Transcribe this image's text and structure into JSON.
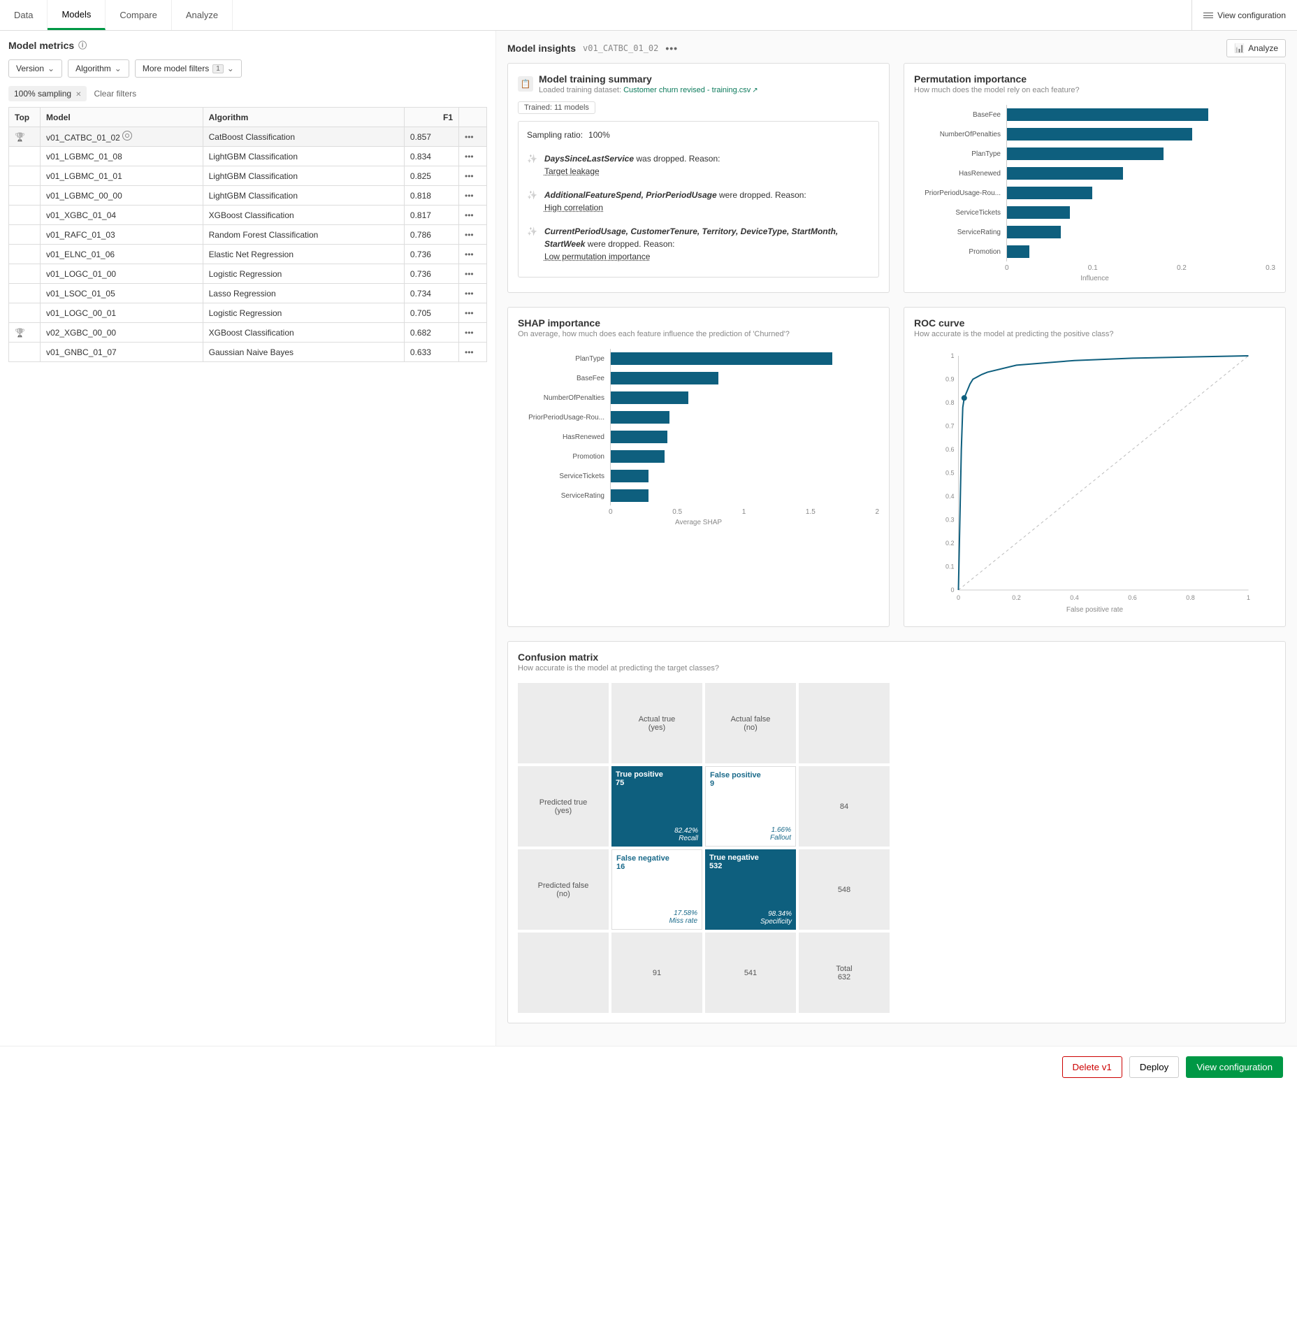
{
  "tabs": [
    "Data",
    "Models",
    "Compare",
    "Analyze"
  ],
  "active_tab": 1,
  "view_config": "View configuration",
  "left": {
    "title": "Model metrics",
    "filters": {
      "version": "Version",
      "algorithm": "Algorithm",
      "more": "More model filters",
      "more_count": "1"
    },
    "chip": "100% sampling",
    "clear": "Clear filters",
    "thead": {
      "top": "Top",
      "model": "Model",
      "algo": "Algorithm",
      "f1": "F1"
    },
    "rows": [
      {
        "top": true,
        "model": "v01_CATBC_01_02",
        "algo": "CatBoost Classification",
        "f1": "0.857",
        "sel": true
      },
      {
        "model": "v01_LGBMC_01_08",
        "algo": "LightGBM Classification",
        "f1": "0.834"
      },
      {
        "model": "v01_LGBMC_01_01",
        "algo": "LightGBM Classification",
        "f1": "0.825"
      },
      {
        "model": "v01_LGBMC_00_00",
        "algo": "LightGBM Classification",
        "f1": "0.818"
      },
      {
        "model": "v01_XGBC_01_04",
        "algo": "XGBoost Classification",
        "f1": "0.817"
      },
      {
        "model": "v01_RAFC_01_03",
        "algo": "Random Forest Classification",
        "f1": "0.786"
      },
      {
        "model": "v01_ELNC_01_06",
        "algo": "Elastic Net Regression",
        "f1": "0.736"
      },
      {
        "model": "v01_LOGC_01_00",
        "algo": "Logistic Regression",
        "f1": "0.736"
      },
      {
        "model": "v01_LSOC_01_05",
        "algo": "Lasso Regression",
        "f1": "0.734"
      },
      {
        "model": "v01_LOGC_00_01",
        "algo": "Logistic Regression",
        "f1": "0.705"
      },
      {
        "top": true,
        "model": "v02_XGBC_00_00",
        "algo": "XGBoost Classification",
        "f1": "0.682"
      },
      {
        "model": "v01_GNBC_01_07",
        "algo": "Gaussian Naive Bayes",
        "f1": "0.633"
      }
    ]
  },
  "right": {
    "title": "Model insights",
    "model_id": "v01_CATBC_01_02",
    "analyze": "Analyze",
    "train": {
      "title": "Model training summary",
      "sub_pref": "Loaded training dataset:",
      "dataset": "Customer churn revised - training.csv",
      "trained": "Trained: 11 models",
      "sampling_pref": "Sampling ratio:",
      "sampling_val": "100%",
      "insights": [
        {
          "bold": "DaysSinceLastService",
          "rest": " was dropped. Reason: ",
          "reason": "Target leakage"
        },
        {
          "bold": "AdditionalFeatureSpend, PriorPeriodUsage",
          "rest": " were dropped. Reason:",
          "reason": "High correlation"
        },
        {
          "bold": "CurrentPeriodUsage, CustomerTenure, Territory, DeviceType, StartMonth, StartWeek",
          "rest": " were dropped. Reason:",
          "reason": "Low permutation importance"
        }
      ]
    },
    "perm": {
      "title": "Permutation importance",
      "sub": "How much does the model rely on each feature?",
      "xlabel": "Influence"
    },
    "shap": {
      "title": "SHAP importance",
      "sub": "On average, how much does each feature influence the prediction of 'Churned'?",
      "xlabel": "Average SHAP"
    },
    "roc": {
      "title": "ROC curve",
      "sub": "How accurate is the model at predicting the positive class?",
      "xlabel": "False positive rate"
    },
    "conf": {
      "title": "Confusion matrix",
      "sub": "How accurate is the model at predicting the target classes?",
      "actual_true": "Actual true\n(yes)",
      "actual_false": "Actual false\n(no)",
      "pred_true": "Predicted true\n(yes)",
      "pred_false": "Predicted false\n(no)",
      "tp": {
        "t": "True positive",
        "n": "75",
        "p": "82.42%",
        "m": "Recall"
      },
      "fp": {
        "t": "False positive",
        "n": "9",
        "p": "1.66%",
        "m": "Fallout"
      },
      "fn": {
        "t": "False negative",
        "n": "16",
        "p": "17.58%",
        "m": "Miss rate"
      },
      "tn": {
        "t": "True negative",
        "n": "532",
        "p": "98.34%",
        "m": "Specificity"
      },
      "row_tot_1": "84",
      "row_tot_2": "548",
      "col_tot_1": "91",
      "col_tot_2": "541",
      "total_label": "Total",
      "total": "632"
    }
  },
  "footer": {
    "delete": "Delete v1",
    "deploy": "Deploy",
    "view": "View configuration"
  },
  "chart_data": [
    {
      "type": "bar",
      "orientation": "h",
      "title": "Permutation importance",
      "xlabel": "Influence",
      "xlim": [
        0,
        0.3
      ],
      "categories": [
        "BaseFee",
        "NumberOfPenalties",
        "PlanType",
        "HasRenewed",
        "PriorPeriodUsage-Rou...",
        "ServiceTickets",
        "ServiceRating",
        "Promotion"
      ],
      "values": [
        0.225,
        0.207,
        0.175,
        0.13,
        0.095,
        0.07,
        0.06,
        0.025
      ],
      "ticks": [
        0,
        0.1,
        0.2,
        0.3
      ]
    },
    {
      "type": "bar",
      "orientation": "h",
      "title": "SHAP importance",
      "xlabel": "Average SHAP",
      "xlim": [
        0,
        2
      ],
      "categories": [
        "PlanType",
        "BaseFee",
        "NumberOfPenalties",
        "PriorPeriodUsage-Rou...",
        "HasRenewed",
        "Promotion",
        "ServiceTickets",
        "ServiceRating"
      ],
      "values": [
        1.65,
        0.8,
        0.58,
        0.44,
        0.42,
        0.4,
        0.28,
        0.28
      ],
      "ticks": [
        0,
        0.5,
        1,
        1.5,
        2
      ]
    },
    {
      "type": "line",
      "title": "ROC curve",
      "xlabel": "False positive rate",
      "xlim": [
        0,
        1
      ],
      "ylim": [
        0,
        1
      ],
      "y_ticks": [
        0,
        0.1,
        0.2,
        0.3,
        0.4,
        0.5,
        0.6,
        0.7,
        0.8,
        0.9,
        1
      ],
      "x_ticks": [
        0,
        0.2,
        0.4,
        0.6,
        0.8,
        1
      ],
      "series": [
        {
          "name": "ROC",
          "x": [
            0,
            0.01,
            0.015,
            0.02,
            0.03,
            0.04,
            0.05,
            0.08,
            0.1,
            0.2,
            0.4,
            0.6,
            0.8,
            1
          ],
          "y": [
            0,
            0.6,
            0.78,
            0.82,
            0.85,
            0.88,
            0.9,
            0.92,
            0.93,
            0.96,
            0.98,
            0.99,
            0.995,
            1
          ]
        },
        {
          "name": "Diagonal",
          "x": [
            0,
            1
          ],
          "y": [
            0,
            1
          ],
          "style": "dashed"
        }
      ]
    }
  ]
}
